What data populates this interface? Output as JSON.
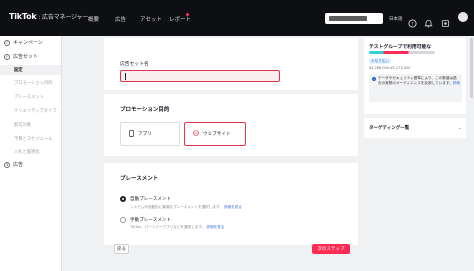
{
  "topbar": {
    "brand": "TikTok",
    "brand_sub": ": 広告マネージャー",
    "nav": [
      "概要",
      "広告",
      "アセット",
      "レポート"
    ],
    "lang": "日本語"
  },
  "sidebar": {
    "campaign": "キャンペーン",
    "adset": "広告セット",
    "subitems": [
      "設定",
      "プロモーション目的",
      "プレースメント",
      "クリエイティブタイプ",
      "配信対象",
      "予算とスケジュール",
      "入札と最適化"
    ],
    "ad_step_number": "3",
    "ad": "広告"
  },
  "adset_name": {
    "label": "広告セット名"
  },
  "promotion": {
    "title": "プロモーション目的",
    "options": [
      "アプリ",
      "ウェブサイト"
    ]
  },
  "placement": {
    "title": "プレースメント",
    "auto_label": "自動プレースメント",
    "auto_desc": "システムが自動的に最適なプレースメントを選択します。",
    "auto_link": "詳細を見る",
    "manual_label": "手動プレースメント",
    "manual_desc": "TikTok、パートナーアプリなどを選択します。",
    "manual_link": "詳細を見る"
  },
  "footer": {
    "back": "戻る",
    "next": "次のステップ"
  },
  "right_panel": {
    "title": "テストグループで利用可能な",
    "badge": "かなり広い",
    "range": "¥4,286,000-¥5,273,000",
    "note": "データやセキュリティ基準により、この数値は過去の実際のオーディエンスを反映しています。",
    "note_link": "詳細",
    "section": "ターゲティング一覧"
  },
  "colors": {
    "accent": "#fe2c55",
    "topbar": "#0e0f12",
    "link": "#3b6ed6"
  }
}
